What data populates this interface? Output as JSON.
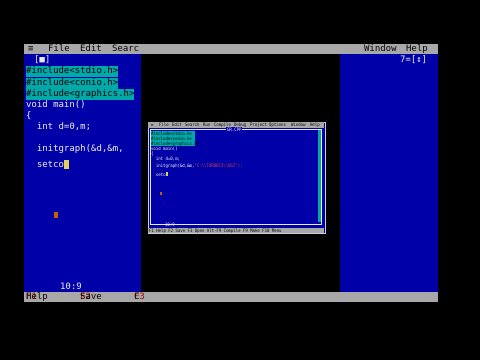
{
  "big": {
    "menu": [
      {
        "label": "≡",
        "hot": ""
      },
      {
        "label": "File",
        "hot": "F"
      },
      {
        "label": "Edit",
        "hot": "E"
      },
      {
        "label": "Searc",
        "hot": "S"
      },
      {
        "label": "Window",
        "hot": "W"
      },
      {
        "label": "Help",
        "hot": "H"
      }
    ],
    "frame_title": "[■]",
    "right_num": "7=[↕]",
    "lines": [
      "#include<stdio.h>",
      "#include<conio.h>",
      "#include<graphics.h>",
      "void main()",
      "{",
      "  int d=0,m;",
      "  initgraph(&d,&m,",
      "  setco"
    ],
    "rowcol": "10:9",
    "status": [
      {
        "key": "F1",
        "label": "Help"
      },
      {
        "key": "F2",
        "label": "Save"
      },
      {
        "key": "F3",
        "label": "C"
      }
    ]
  },
  "win": {
    "menu": [
      "≡",
      "File",
      "Edit",
      "Search",
      "Run",
      "Compile",
      "Debug",
      "Project",
      "Options",
      "Window",
      "Help"
    ],
    "title": "GR.CPP",
    "lines": [
      "#include<stdio.h>",
      "#include<conio.h>",
      "#include<graphics.h>",
      "void main()",
      "{",
      "  int d=0,m;",
      "",
      "  initgraph(&d,&m,",
      "\"C:\\\\TURBOC3\\\\BGI\");",
      "",
      "  setco"
    ],
    "rowcol": "10:9",
    "status": "F1 Help  F2 Save  F3 Open  Alt-F9 Compile  F9 Make  F10 Menu"
  }
}
